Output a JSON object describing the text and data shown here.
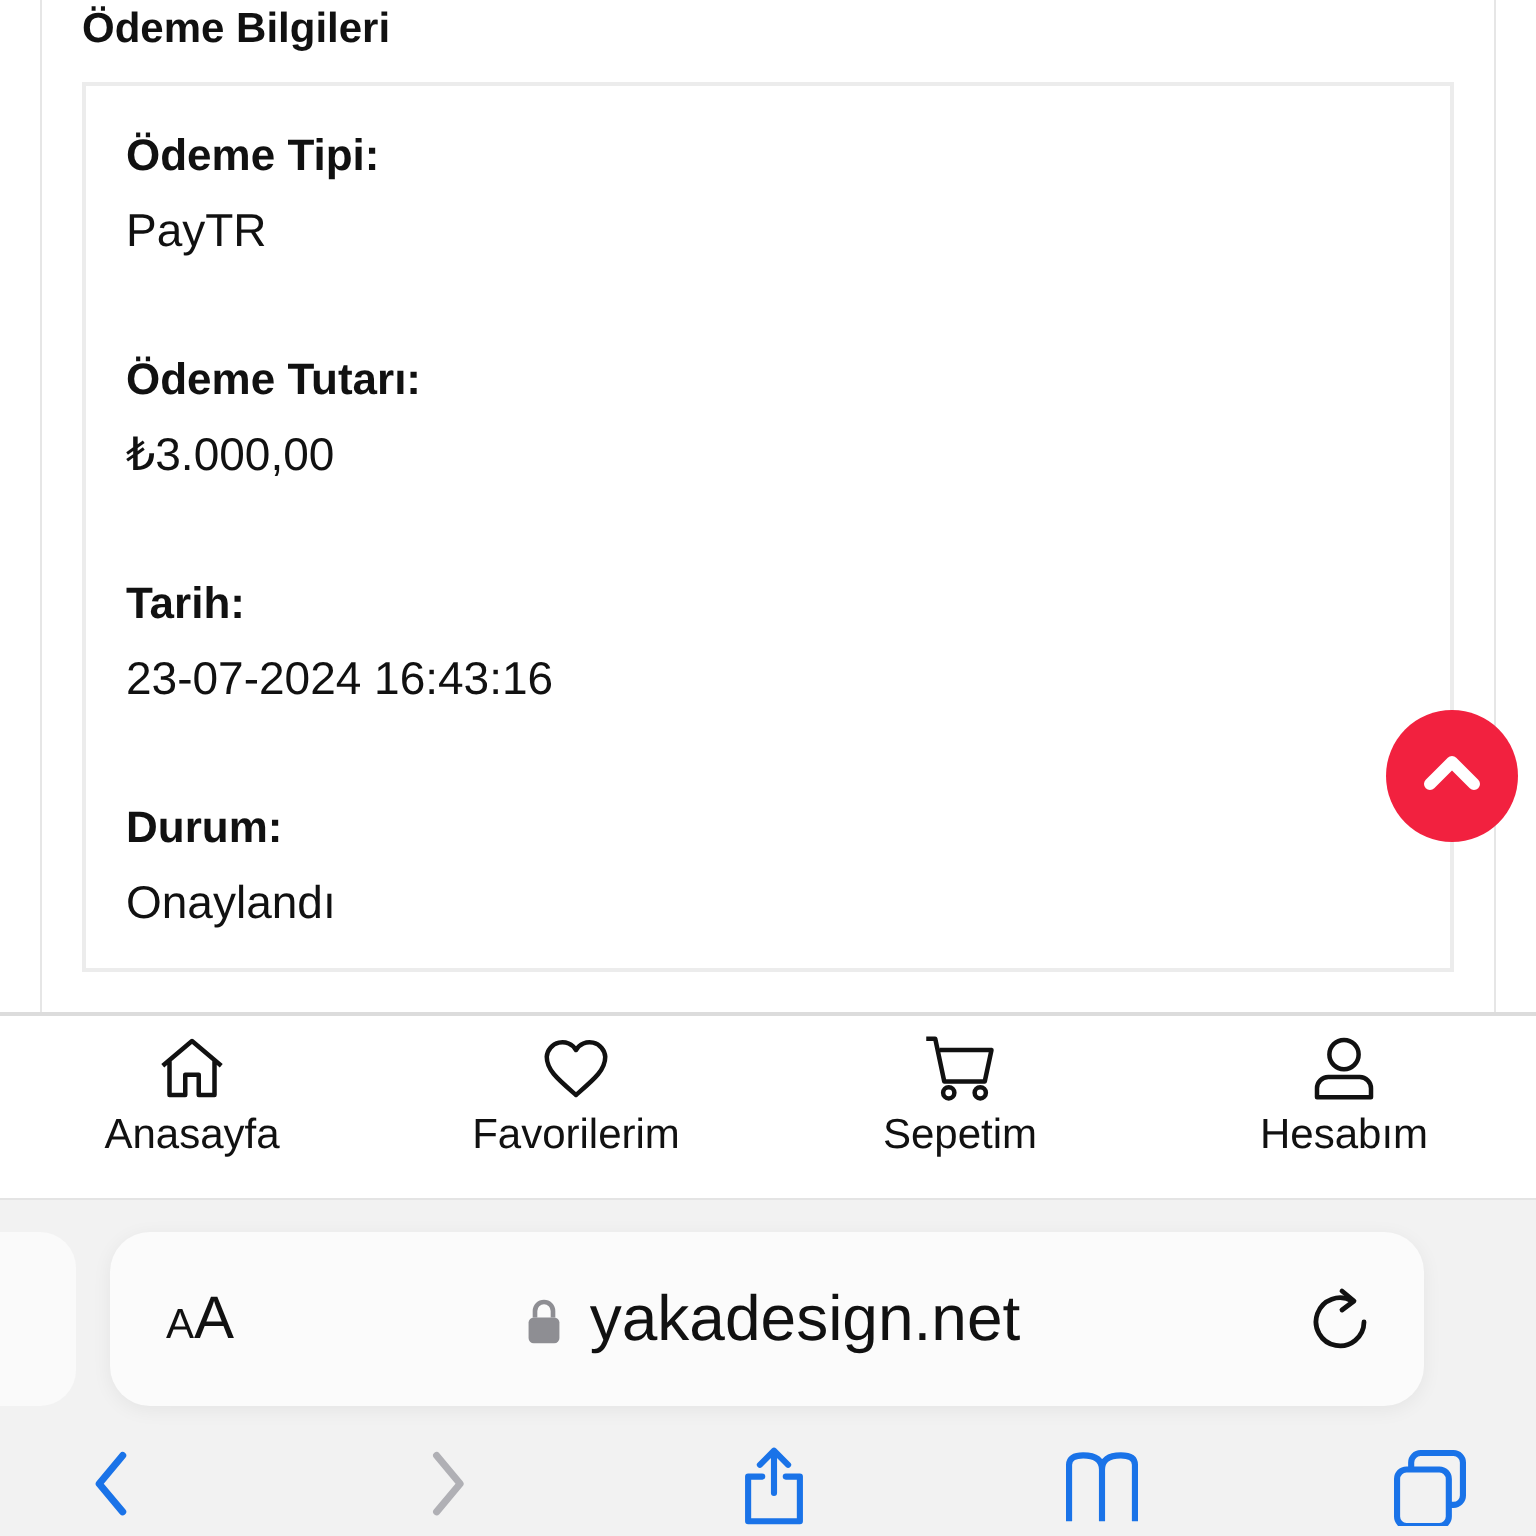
{
  "section": {
    "title": "Ödeme Bilgileri",
    "fields": [
      {
        "label": "Ödeme Tipi:",
        "value": "PayTR"
      },
      {
        "label": "Ödeme Tutarı:",
        "value": "₺3.000,00"
      },
      {
        "label": "Tarih:",
        "value": "23-07-2024 16:43:16"
      },
      {
        "label": "Durum:",
        "value": "Onaylandı"
      }
    ]
  },
  "bottom_nav": [
    {
      "kind": "home",
      "label": "Anasayfa"
    },
    {
      "kind": "favorites",
      "label": "Favorilerim"
    },
    {
      "kind": "cart",
      "label": "Sepetim"
    },
    {
      "kind": "account",
      "label": "Hesabım"
    }
  ],
  "browser": {
    "text_size_button": "AA",
    "url": "yakadesign.net"
  },
  "toolbar": [
    {
      "kind": "back",
      "disabled": false
    },
    {
      "kind": "forward",
      "disabled": true
    },
    {
      "kind": "share",
      "disabled": false
    },
    {
      "kind": "bookmarks",
      "disabled": false
    },
    {
      "kind": "tabs",
      "disabled": false
    }
  ]
}
